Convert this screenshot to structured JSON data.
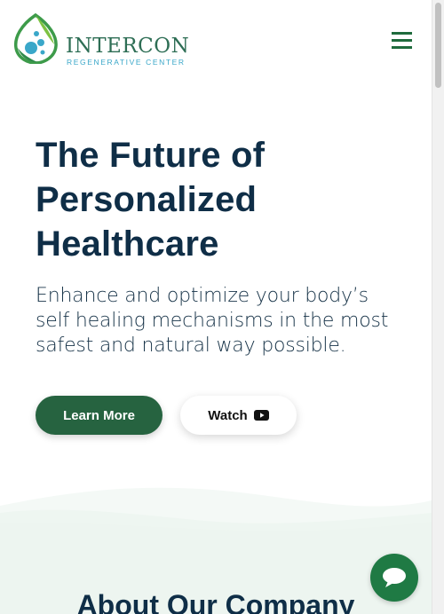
{
  "header": {
    "logo_name": "INTERCON",
    "logo_tagline": "REGENERATIVE CENTER",
    "logo_icon": "leaf-drops-logo-icon",
    "menu_icon": "hamburger-menu-icon"
  },
  "hero": {
    "title": "The Future of Personalized Healthcare",
    "subtitle": "Enhance and optimize your body’s self healing mechanisms in the most safest and natural way possible.",
    "learn_more_label": "Learn More",
    "watch_label": "Watch",
    "watch_icon": "youtube-play-icon"
  },
  "about": {
    "title": "About Our Company"
  },
  "chat": {
    "icon": "chat-bubble-icon"
  },
  "colors": {
    "brand_green": "#266340",
    "title_navy": "#0f2e47",
    "logo_blue": "#3aa7c9",
    "wave_tint": "#eef6f1"
  }
}
